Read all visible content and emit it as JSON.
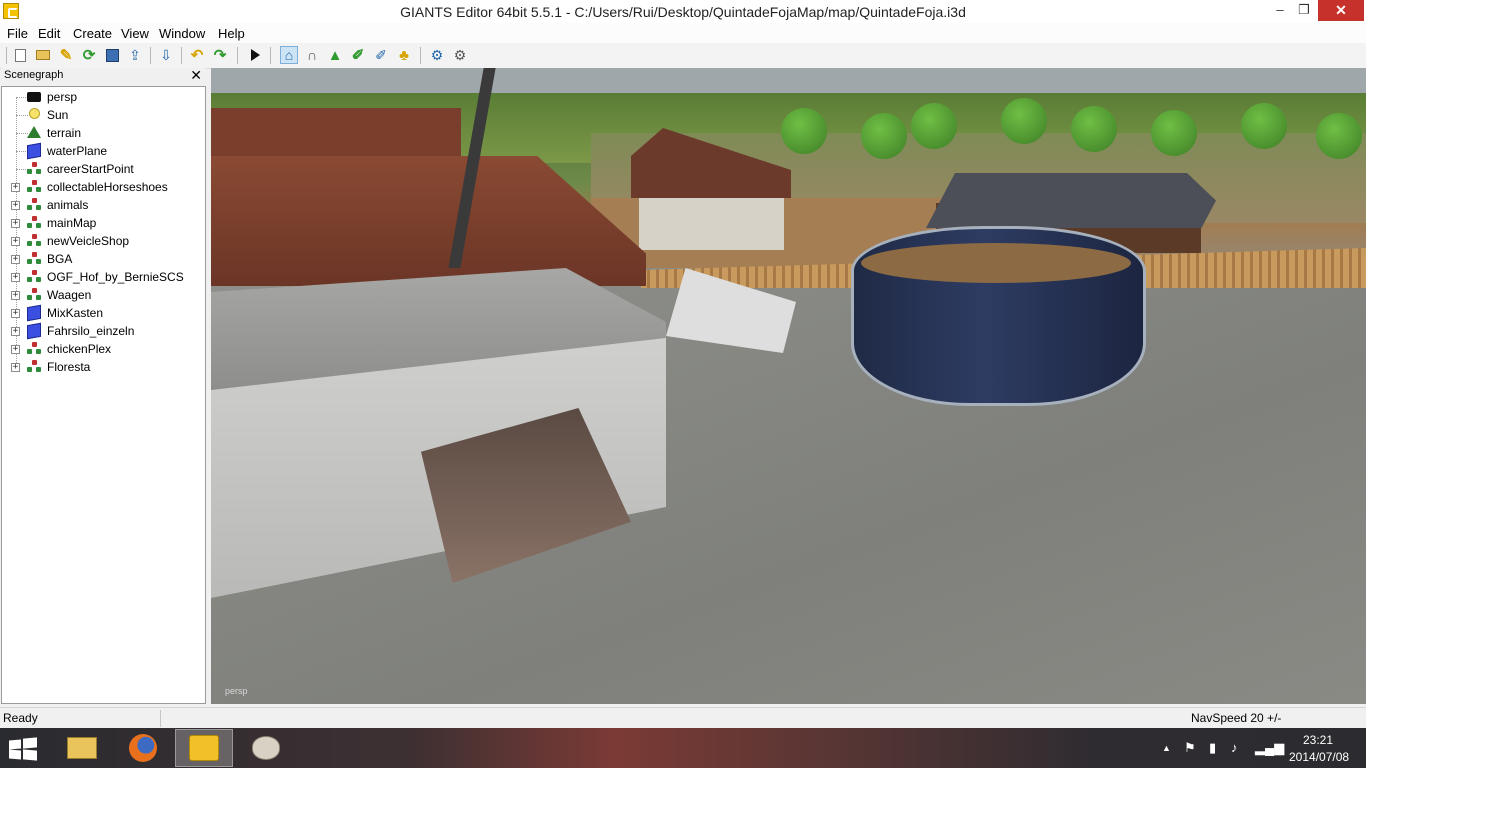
{
  "window": {
    "title": "GIANTS Editor 64bit 5.5.1 - C:/Users/Rui/Desktop/QuintadeFojaMap/map/QuintadeFoja.i3d",
    "controls": {
      "minimize": "‒",
      "maximize": "❐",
      "close": "✕"
    }
  },
  "menu": [
    "File",
    "Edit",
    "Create",
    "View",
    "Window",
    "Help"
  ],
  "toolbar": {
    "icons": [
      "new-file-icon",
      "open-folder-icon",
      "edit-icon",
      "reload-icon",
      "save-icon",
      "export-icon",
      "import-icon",
      "undo-icon",
      "redo-icon",
      "play-icon",
      "select-mode-icon",
      "magnet-icon",
      "terrain-sculpt-icon",
      "terrain-paint-icon",
      "foliage-paint-icon",
      "tree-paint-icon",
      "settings-sync-icon",
      "gear-refresh-icon"
    ]
  },
  "scenegraph": {
    "title": "Scenegraph",
    "close": "✕",
    "nodes": [
      {
        "label": "persp",
        "icon": "camera-icon",
        "expandable": false
      },
      {
        "label": "Sun",
        "icon": "light-bulb-icon",
        "expandable": false
      },
      {
        "label": "terrain",
        "icon": "terrain-icon",
        "expandable": false
      },
      {
        "label": "waterPlane",
        "icon": "shape-cube-icon",
        "expandable": false
      },
      {
        "label": "careerStartPoint",
        "icon": "transformgroup-icon",
        "expandable": false
      },
      {
        "label": "collectableHorseshoes",
        "icon": "transformgroup-icon",
        "expandable": true
      },
      {
        "label": "animals",
        "icon": "transformgroup-icon",
        "expandable": true
      },
      {
        "label": "mainMap",
        "icon": "transformgroup-icon",
        "expandable": true
      },
      {
        "label": "newVeicleShop",
        "icon": "transformgroup-icon",
        "expandable": true
      },
      {
        "label": "BGA",
        "icon": "transformgroup-icon",
        "expandable": true
      },
      {
        "label": "OGF_Hof_by_BernieSCS",
        "icon": "transformgroup-icon",
        "expandable": true
      },
      {
        "label": "Waagen",
        "icon": "transformgroup-icon",
        "expandable": true
      },
      {
        "label": "MixKasten",
        "icon": "shape-cube-icon",
        "expandable": true
      },
      {
        "label": "Fahrsilo_einzeln",
        "icon": "shape-cube-icon",
        "expandable": true
      },
      {
        "label": "chickenPlex",
        "icon": "transformgroup-icon",
        "expandable": true
      },
      {
        "label": "Floresta",
        "icon": "transformgroup-icon",
        "expandable": true
      }
    ]
  },
  "viewport": {
    "camera_label": "persp"
  },
  "status": {
    "left": "Ready",
    "right": "NavSpeed 20 +/-"
  },
  "taskbar": {
    "apps": [
      "file-explorer-icon",
      "firefox-icon",
      "giants-editor-icon",
      "paint-icon"
    ],
    "active_app": "giants-editor-icon",
    "tray": [
      "show-hidden-icons",
      "action-center-flag-icon",
      "power-icon",
      "volume-icon",
      "network-signal-icon"
    ],
    "time": "23:21",
    "date": "2014/07/08"
  },
  "colors": {
    "close_button": "#c7312b",
    "app_accent": "#f5c200",
    "cube_icon": "#3b4fe0"
  }
}
